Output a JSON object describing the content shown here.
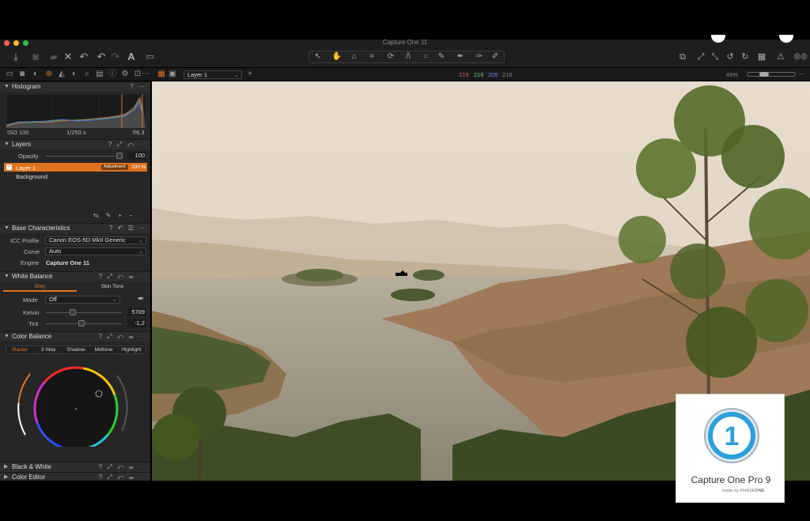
{
  "window": {
    "title": "Capture One 11"
  },
  "toolbar": {
    "left_icons": [
      "import-icon",
      "camera-icon",
      "folder-icon",
      "delete-icon",
      "undo-history-icon",
      "undo-icon",
      "redo-icon",
      "text-icon",
      "edit-icon"
    ],
    "right_icons": [
      "stack-icon",
      "expand-icon",
      "collapse-icon",
      "rotate-left-icon",
      "rotate-right-icon",
      "grid-icon",
      "warning-icon",
      "glasses-icon"
    ]
  },
  "viewer_bar": {
    "layer_select": "Layer 1",
    "rgb": {
      "r": "219",
      "g": "216",
      "b": "205",
      "l": "216"
    },
    "zoom": "49%"
  },
  "histogram": {
    "title": "Histogram",
    "iso": "ISO 100",
    "shutter": "1/250 s",
    "aperture": "f/6.3"
  },
  "layers": {
    "title": "Layers",
    "opacity_label": "Opacity",
    "opacity_value": "100",
    "items": [
      {
        "name": "Layer 1",
        "tag": "Adjustment",
        "opacity": "100 %",
        "selected": true
      },
      {
        "name": "Background",
        "selected": false
      }
    ]
  },
  "base": {
    "title": "Base Characteristics",
    "icc_label": "ICC Profile",
    "icc_value": "Canon EOS-5D MkII Generic",
    "curve_label": "Curve",
    "curve_value": "Auto",
    "engine_label": "Engine",
    "engine_value": "Capture One 11"
  },
  "white_balance": {
    "title": "White Balance",
    "tabs": [
      "Grey",
      "Skin Tone"
    ],
    "mode_label": "Mode",
    "mode_value": "Off",
    "kelvin_label": "Kelvin",
    "kelvin_value": "5709",
    "tint_label": "Tint",
    "tint_value": "-1,2"
  },
  "color_balance": {
    "title": "Color Balance",
    "tabs": [
      "Master",
      "3-Way",
      "Shadow",
      "Midtone",
      "Highlight"
    ]
  },
  "bw": {
    "title": "Black & White"
  },
  "color_editor": {
    "title": "Color Editor"
  },
  "badge": {
    "line1": "Capture One Pro 9",
    "made_by": "made by",
    "brand_a": "PHASE",
    "brand_b": "ONE",
    "numeral": "1"
  },
  "colors": {
    "accent": "#e0731f",
    "panel": "#262626"
  }
}
